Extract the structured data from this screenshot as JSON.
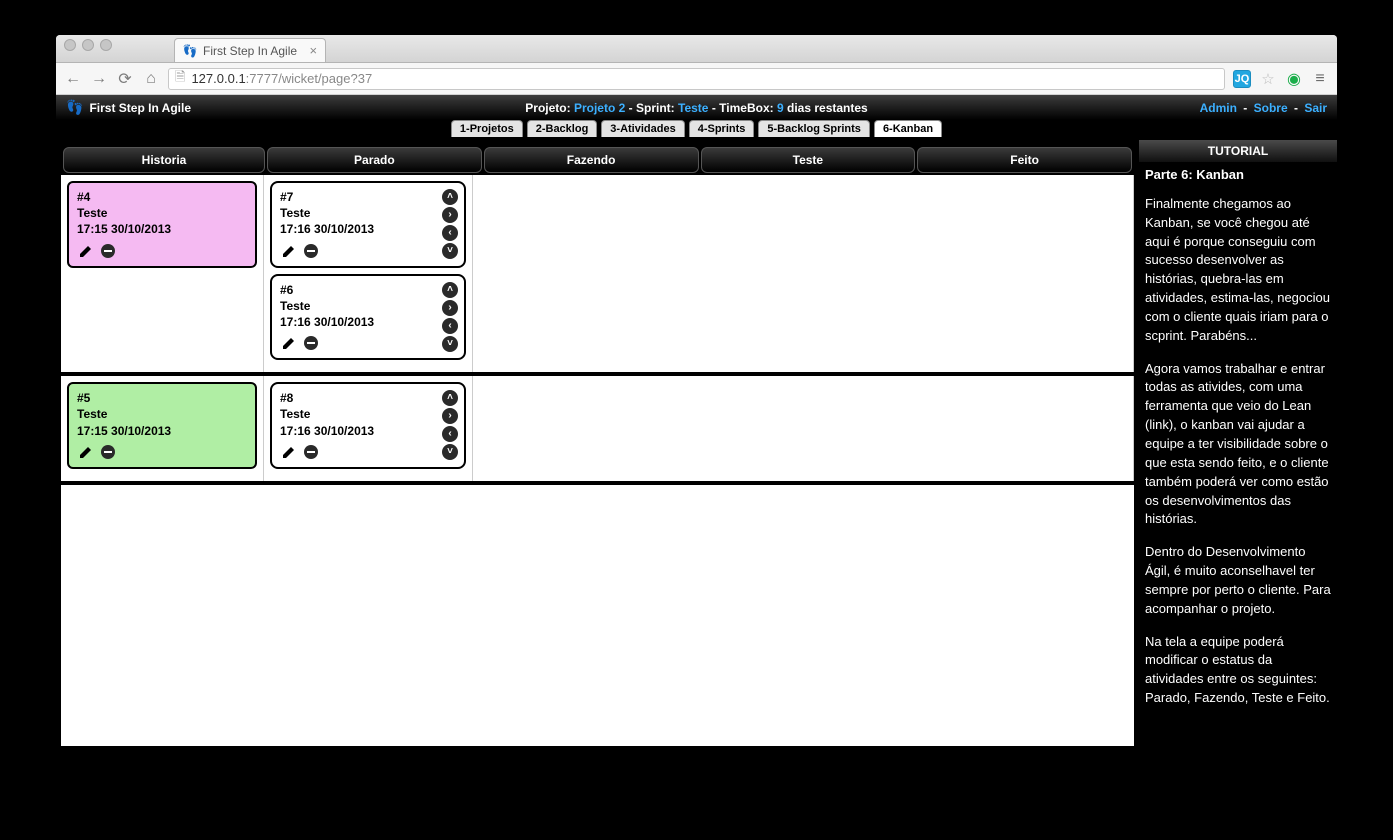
{
  "browser": {
    "tab_title": "First Step In Agile",
    "url_host": "127.0.0.1",
    "url_port": ":7777",
    "url_path": "/wicket/page?37"
  },
  "header": {
    "app_name": "First Step In Agile",
    "projeto_label": "Projeto:",
    "projeto_value": "Projeto 2",
    "sprint_label": "Sprint:",
    "sprint_value": "Teste",
    "timebox_label": "TimeBox:",
    "timebox_value": "9",
    "timebox_suffix": "dias restantes",
    "sep": " - ",
    "links": {
      "admin": "Admin",
      "sobre": "Sobre",
      "sair": "Sair"
    }
  },
  "nav_tabs": [
    {
      "label": "1-Projetos",
      "active": false
    },
    {
      "label": "2-Backlog",
      "active": false
    },
    {
      "label": "3-Atividades",
      "active": false
    },
    {
      "label": "4-Sprints",
      "active": false
    },
    {
      "label": "5-Backlog Sprints",
      "active": false
    },
    {
      "label": "6-Kanban",
      "active": true
    }
  ],
  "columns": {
    "historia": "Historia",
    "parado": "Parado",
    "fazendo": "Fazendo",
    "teste": "Teste",
    "feito": "Feito"
  },
  "lanes": [
    {
      "story": {
        "id": "#4",
        "title": "Teste",
        "timestamp": "17:15 30/10/2013",
        "color": "pink"
      },
      "parado": [
        {
          "id": "#7",
          "title": "Teste",
          "timestamp": "17:16 30/10/2013"
        },
        {
          "id": "#6",
          "title": "Teste",
          "timestamp": "17:16 30/10/2013"
        }
      ]
    },
    {
      "story": {
        "id": "#5",
        "title": "Teste",
        "timestamp": "17:15 30/10/2013",
        "color": "green"
      },
      "parado": [
        {
          "id": "#8",
          "title": "Teste",
          "timestamp": "17:16 30/10/2013"
        }
      ]
    }
  ],
  "tutorial": {
    "header": "TUTORIAL",
    "subtitle": "Parte 6: Kanban",
    "p1": "Finalmente chegamos ao Kanban, se você chegou até aqui é porque conseguiu com sucesso desenvolver as histórias, quebra-las em atividades, estima-las, negociou com o cliente quais iriam para o scprint. Parabéns...",
    "p2": "Agora vamos trabalhar e entrar todas as ativides, com uma ferramenta que veio do Lean (link), o kanban vai ajudar a equipe a ter visibilidade sobre o que esta sendo feito, e o cliente também poderá ver como estão os desenvolvimentos das histórias.",
    "p3": "Dentro do Desenvolvimento Ágil, é muito aconselhavel ter sempre por perto o cliente. Para acompanhar o projeto.",
    "p4": "Na tela a equipe poderá modificar o estatus da atividades entre os seguintes: Parado, Fazendo, Teste e Feito."
  }
}
